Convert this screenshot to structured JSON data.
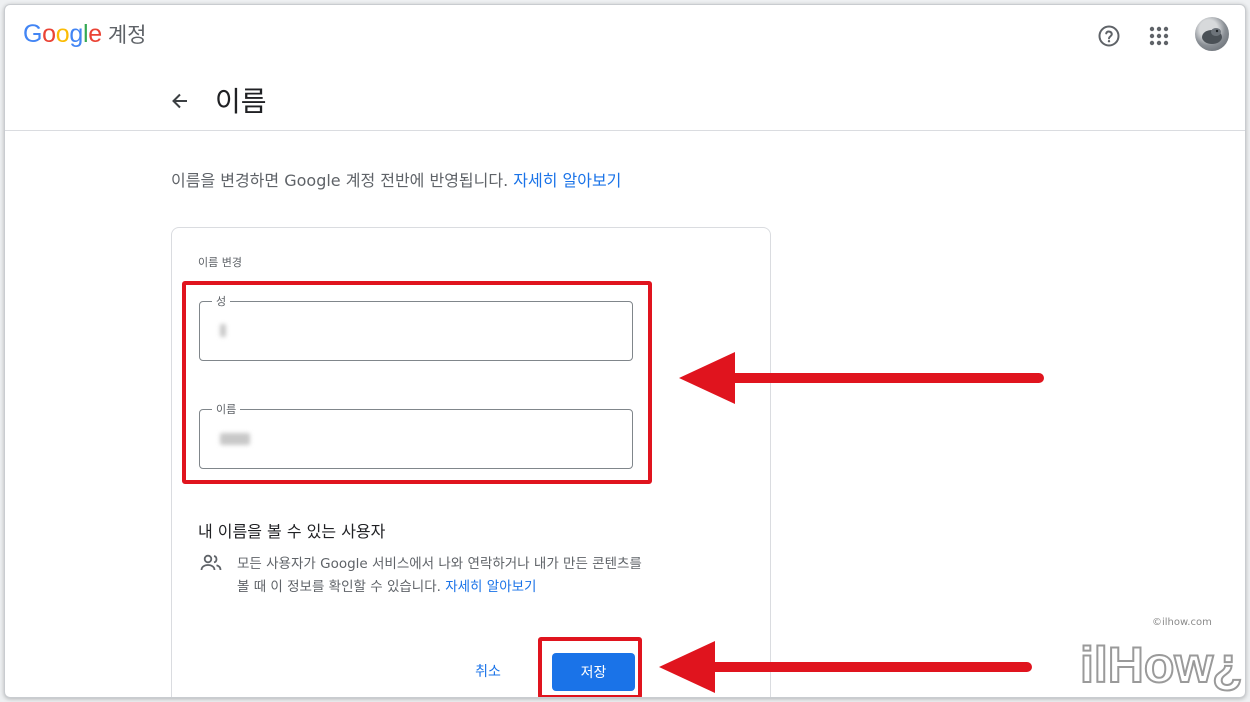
{
  "header": {
    "logo_letters": [
      {
        "ch": "G",
        "color": "#4285F4"
      },
      {
        "ch": "o",
        "color": "#EA4335"
      },
      {
        "ch": "o",
        "color": "#FBBC05"
      },
      {
        "ch": "g",
        "color": "#4285F4"
      },
      {
        "ch": "l",
        "color": "#34A853"
      },
      {
        "ch": "e",
        "color": "#EA4335"
      }
    ],
    "product_name": "계정",
    "icons": [
      "help-icon",
      "apps-icon"
    ]
  },
  "page": {
    "title": "이름",
    "intro_text": "이름을 변경하면 Google 계정 전반에 반영됩니다.",
    "intro_link": "자세히 알아보기"
  },
  "card": {
    "heading": "이름 변경",
    "last_name_label": "성",
    "last_name_value": "",
    "first_name_label": "이름",
    "first_name_value": "",
    "visibility_title": "내 이름을 볼 수 있는 사용자",
    "visibility_text": "모든 사용자가 Google 서비스에서 나와 연락하거나 내가 만든 콘텐츠를 볼 때 이 정보를 확인할 수 있습니다.",
    "visibility_link": "자세히 알아보기",
    "cancel_label": "취소",
    "save_label": "저장"
  },
  "annotation": {
    "highlight_color": "#E0141E",
    "watermark_site": "©ilhow.com",
    "watermark_brand": "ilHow"
  },
  "colors": {
    "accent": "#1A73E8",
    "text_primary": "#202124",
    "text_secondary": "#5F6368"
  }
}
